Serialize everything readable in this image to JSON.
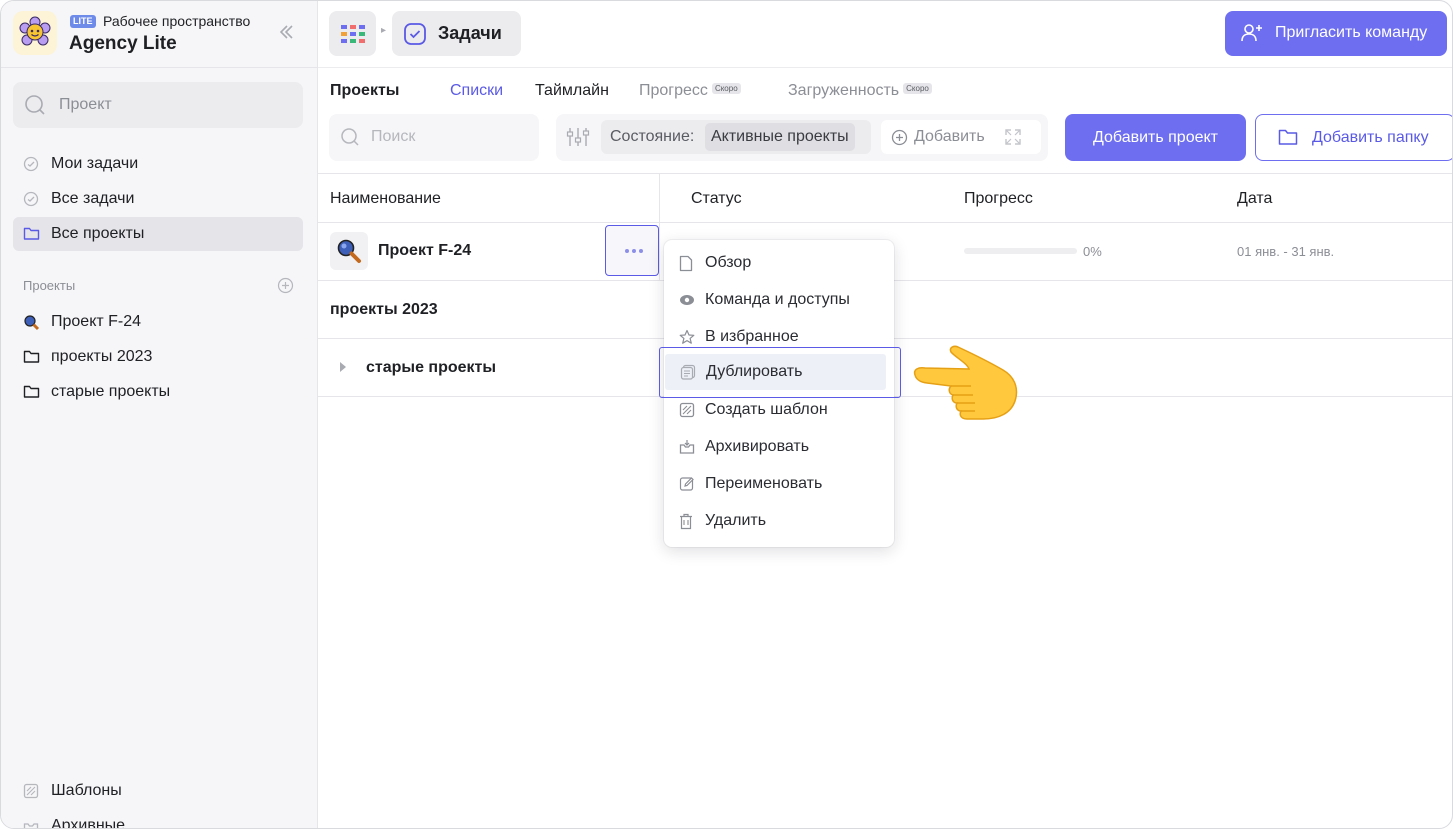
{
  "workspace": {
    "badge": "LITE",
    "subtitle": "Рабочее пространство",
    "name": "Agency Lite"
  },
  "sidebar": {
    "search_placeholder": "Проект",
    "nav": [
      {
        "label": "Мои задачи",
        "icon": "check-circle-icon"
      },
      {
        "label": "Все задачи",
        "icon": "check-circle-icon"
      },
      {
        "label": "Все проекты",
        "icon": "folder-icon",
        "active": true
      }
    ],
    "projects_title": "Проекты",
    "projects": [
      {
        "label": "Проект F-24",
        "icon": "magnifier-emoji-icon"
      },
      {
        "label": "проекты 2023",
        "icon": "folder-icon"
      },
      {
        "label": "старые проекты",
        "icon": "folder-icon"
      }
    ],
    "bottom": [
      {
        "label": "Шаблоны",
        "icon": "template-icon"
      },
      {
        "label": "Архивные",
        "icon": "archive-icon"
      }
    ]
  },
  "topbar": {
    "section": "Задачи",
    "invite": "Пригласить команду"
  },
  "tabs": [
    {
      "label": "Проекты"
    },
    {
      "label": "Списки"
    },
    {
      "label": "Таймлайн"
    },
    {
      "label": "Прогресс",
      "badge": "Скоро"
    },
    {
      "label": "Загруженность",
      "badge": "Скоро"
    }
  ],
  "toolbar": {
    "search_placeholder": "Поиск",
    "state_key": "Состояние:",
    "state_value": "Активные проекты",
    "add_filter": "Добавить",
    "add_project": "Добавить проект",
    "add_folder": "Добавить папку"
  },
  "table": {
    "columns": [
      "Наименование",
      "Статус",
      "Прогресс",
      "Дата"
    ],
    "row": {
      "name": "Проект F-24",
      "progress_text": "0%",
      "progress": 0,
      "date": "01 янв. - 31 янв."
    },
    "group": "проекты 2023",
    "folder": "старые проекты"
  },
  "menu": [
    {
      "label": "Обзор",
      "icon": "page-icon"
    },
    {
      "label": "Команда и доступы",
      "icon": "eye-icon"
    },
    {
      "label": "В избранное",
      "icon": "star-icon"
    },
    {
      "label": "Дублировать",
      "icon": "copy-icon",
      "highlighted": true
    },
    {
      "label": "Создать шаблон",
      "icon": "template-icon"
    },
    {
      "label": "Архивировать",
      "icon": "archive-icon"
    },
    {
      "label": "Переименовать",
      "icon": "edit-icon"
    },
    {
      "label": "Удалить",
      "icon": "trash-icon"
    }
  ],
  "colors": {
    "accent": "#6e6ef0",
    "sidebar_bg": "#f6f6f8",
    "highlight": "#5a5ae6"
  }
}
